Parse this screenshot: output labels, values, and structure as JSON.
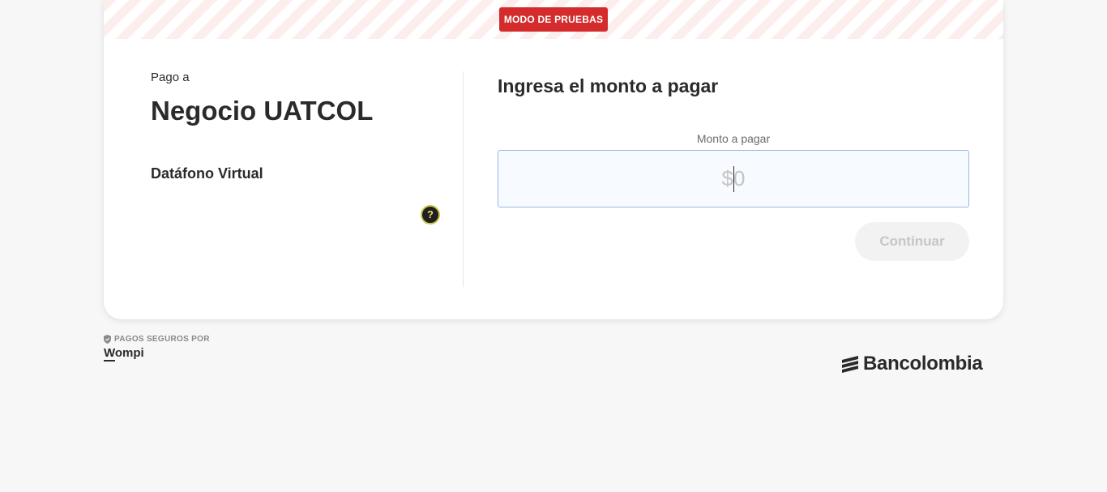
{
  "banner": {
    "badge_label": "MODO DE PRUEBAS"
  },
  "merchant": {
    "pay_to_label": "Pago a",
    "name": "Negocio UATCOL",
    "product": "Datáfono Virtual",
    "help_icon_glyph": "?"
  },
  "payment": {
    "heading": "Ingresa el monto a pagar",
    "amount_label": "Monto a pagar",
    "amount_placeholder": "$0",
    "amount_value": "",
    "continue_label": "Continuar"
  },
  "footer": {
    "secure_label": "PAGOS SEGUROS POR",
    "provider_logo": "Wompi",
    "bank_logo": "Bancolombia"
  },
  "icons": {
    "help": "question-circle-icon",
    "secure": "shield-icon",
    "bank": "bancolombia-logo-icon"
  },
  "colors": {
    "test_badge": "#d42c2c",
    "banner_stripe": "#fdeeee",
    "input_border": "#9db7e8",
    "button_disabled_bg": "#f2f2f2",
    "page_background": "#f7f7f7"
  }
}
